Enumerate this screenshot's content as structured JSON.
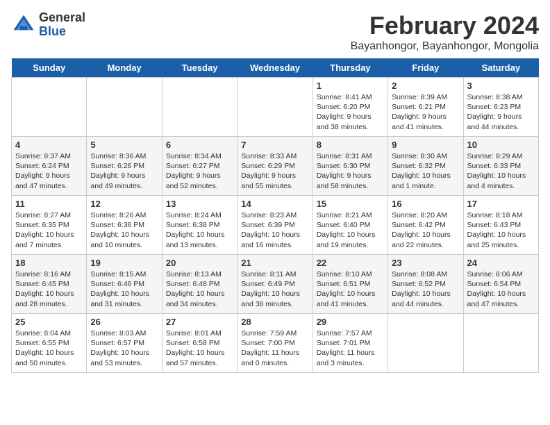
{
  "logo": {
    "general": "General",
    "blue": "Blue"
  },
  "header": {
    "month": "February 2024",
    "location": "Bayanhongor, Bayanhongor, Mongolia"
  },
  "weekdays": [
    "Sunday",
    "Monday",
    "Tuesday",
    "Wednesday",
    "Thursday",
    "Friday",
    "Saturday"
  ],
  "weeks": [
    [
      {
        "day": "",
        "info": ""
      },
      {
        "day": "",
        "info": ""
      },
      {
        "day": "",
        "info": ""
      },
      {
        "day": "",
        "info": ""
      },
      {
        "day": "1",
        "info": "Sunrise: 8:41 AM\nSunset: 6:20 PM\nDaylight: 9 hours and 38 minutes."
      },
      {
        "day": "2",
        "info": "Sunrise: 8:39 AM\nSunset: 6:21 PM\nDaylight: 9 hours and 41 minutes."
      },
      {
        "day": "3",
        "info": "Sunrise: 8:38 AM\nSunset: 6:23 PM\nDaylight: 9 hours and 44 minutes."
      }
    ],
    [
      {
        "day": "4",
        "info": "Sunrise: 8:37 AM\nSunset: 6:24 PM\nDaylight: 9 hours and 47 minutes."
      },
      {
        "day": "5",
        "info": "Sunrise: 8:36 AM\nSunset: 6:26 PM\nDaylight: 9 hours and 49 minutes."
      },
      {
        "day": "6",
        "info": "Sunrise: 8:34 AM\nSunset: 6:27 PM\nDaylight: 9 hours and 52 minutes."
      },
      {
        "day": "7",
        "info": "Sunrise: 8:33 AM\nSunset: 6:29 PM\nDaylight: 9 hours and 55 minutes."
      },
      {
        "day": "8",
        "info": "Sunrise: 8:31 AM\nSunset: 6:30 PM\nDaylight: 9 hours and 58 minutes."
      },
      {
        "day": "9",
        "info": "Sunrise: 8:30 AM\nSunset: 6:32 PM\nDaylight: 10 hours and 1 minute."
      },
      {
        "day": "10",
        "info": "Sunrise: 8:29 AM\nSunset: 6:33 PM\nDaylight: 10 hours and 4 minutes."
      }
    ],
    [
      {
        "day": "11",
        "info": "Sunrise: 8:27 AM\nSunset: 6:35 PM\nDaylight: 10 hours and 7 minutes."
      },
      {
        "day": "12",
        "info": "Sunrise: 8:26 AM\nSunset: 6:36 PM\nDaylight: 10 hours and 10 minutes."
      },
      {
        "day": "13",
        "info": "Sunrise: 8:24 AM\nSunset: 6:38 PM\nDaylight: 10 hours and 13 minutes."
      },
      {
        "day": "14",
        "info": "Sunrise: 8:23 AM\nSunset: 6:39 PM\nDaylight: 10 hours and 16 minutes."
      },
      {
        "day": "15",
        "info": "Sunrise: 8:21 AM\nSunset: 6:40 PM\nDaylight: 10 hours and 19 minutes."
      },
      {
        "day": "16",
        "info": "Sunrise: 8:20 AM\nSunset: 6:42 PM\nDaylight: 10 hours and 22 minutes."
      },
      {
        "day": "17",
        "info": "Sunrise: 8:18 AM\nSunset: 6:43 PM\nDaylight: 10 hours and 25 minutes."
      }
    ],
    [
      {
        "day": "18",
        "info": "Sunrise: 8:16 AM\nSunset: 6:45 PM\nDaylight: 10 hours and 28 minutes."
      },
      {
        "day": "19",
        "info": "Sunrise: 8:15 AM\nSunset: 6:46 PM\nDaylight: 10 hours and 31 minutes."
      },
      {
        "day": "20",
        "info": "Sunrise: 8:13 AM\nSunset: 6:48 PM\nDaylight: 10 hours and 34 minutes."
      },
      {
        "day": "21",
        "info": "Sunrise: 8:11 AM\nSunset: 6:49 PM\nDaylight: 10 hours and 38 minutes."
      },
      {
        "day": "22",
        "info": "Sunrise: 8:10 AM\nSunset: 6:51 PM\nDaylight: 10 hours and 41 minutes."
      },
      {
        "day": "23",
        "info": "Sunrise: 8:08 AM\nSunset: 6:52 PM\nDaylight: 10 hours and 44 minutes."
      },
      {
        "day": "24",
        "info": "Sunrise: 8:06 AM\nSunset: 6:54 PM\nDaylight: 10 hours and 47 minutes."
      }
    ],
    [
      {
        "day": "25",
        "info": "Sunrise: 8:04 AM\nSunset: 6:55 PM\nDaylight: 10 hours and 50 minutes."
      },
      {
        "day": "26",
        "info": "Sunrise: 8:03 AM\nSunset: 6:57 PM\nDaylight: 10 hours and 53 minutes."
      },
      {
        "day": "27",
        "info": "Sunrise: 8:01 AM\nSunset: 6:58 PM\nDaylight: 10 hours and 57 minutes."
      },
      {
        "day": "28",
        "info": "Sunrise: 7:59 AM\nSunset: 7:00 PM\nDaylight: 11 hours and 0 minutes."
      },
      {
        "day": "29",
        "info": "Sunrise: 7:57 AM\nSunset: 7:01 PM\nDaylight: 11 hours and 3 minutes."
      },
      {
        "day": "",
        "info": ""
      },
      {
        "day": "",
        "info": ""
      }
    ]
  ]
}
